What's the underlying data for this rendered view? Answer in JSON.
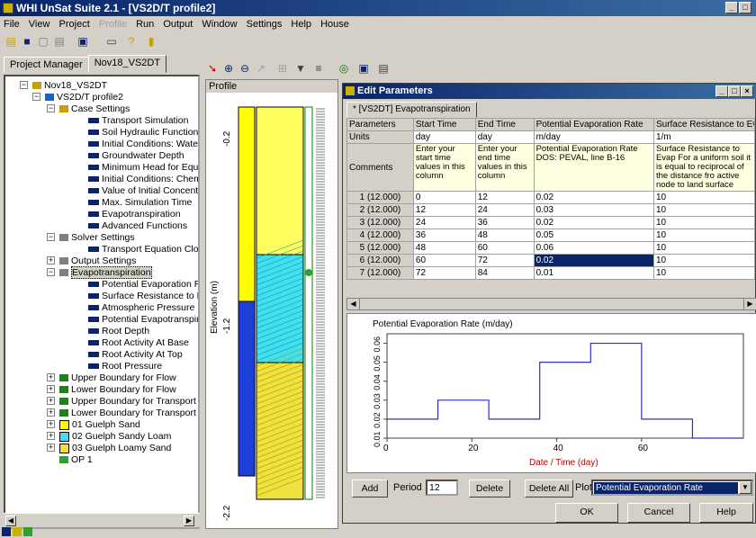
{
  "app": {
    "title": "WHI UnSat Suite 2.1 - [VS2D/T profile2]"
  },
  "menu": [
    "File",
    "View",
    "Project",
    "Profile",
    "Run",
    "Output",
    "Window",
    "Settings",
    "Help",
    "House"
  ],
  "left_tabs": [
    "Project Manager",
    "Nov18_VS2DT"
  ],
  "tree": [
    {
      "label": "Nov18_VS2DT",
      "x": 30,
      "y": 4,
      "exp": "-",
      "icon": "folder"
    },
    {
      "label": "VS2D/T profile2",
      "x": 44,
      "y": 17,
      "exp": "-",
      "icon": "flag"
    },
    {
      "label": "Case Settings",
      "x": 60,
      "y": 30,
      "exp": "-",
      "icon": "tool"
    },
    {
      "label": "Transport Simulation",
      "x": 92,
      "y": 43,
      "icon": "item"
    },
    {
      "label": "Soil Hydraulic Function",
      "x": 92,
      "y": 56,
      "icon": "item"
    },
    {
      "label": "Initial Conditions: Water",
      "x": 92,
      "y": 69,
      "icon": "item"
    },
    {
      "label": "Groundwater Depth",
      "x": 92,
      "y": 82,
      "icon": "item"
    },
    {
      "label": "Minimum Head for Equilibriu",
      "x": 92,
      "y": 95,
      "icon": "item"
    },
    {
      "label": "Initial Conditions: Chemical",
      "x": 92,
      "y": 108,
      "icon": "item"
    },
    {
      "label": "Value of Initial Concentratio",
      "x": 92,
      "y": 121,
      "icon": "item"
    },
    {
      "label": "Max. Simulation Time",
      "x": 92,
      "y": 134,
      "icon": "item"
    },
    {
      "label": "Evapotranspiration",
      "x": 92,
      "y": 147,
      "icon": "item"
    },
    {
      "label": "Advanced Functions",
      "x": 92,
      "y": 160,
      "icon": "item"
    },
    {
      "label": "Solver Settings",
      "x": 60,
      "y": 173,
      "exp": "-",
      "icon": "grid"
    },
    {
      "label": "Transport Equation Closure",
      "x": 92,
      "y": 186,
      "icon": "item"
    },
    {
      "label": "Output Settings",
      "x": 60,
      "y": 199,
      "exp": "+",
      "icon": "grid"
    },
    {
      "label": "Evapotranspiration",
      "x": 60,
      "y": 212,
      "exp": "-",
      "icon": "grid",
      "selected": true
    },
    {
      "label": "Potential Evaporation Rate",
      "x": 92,
      "y": 225,
      "icon": "item"
    },
    {
      "label": "Surface Resistance to Evap",
      "x": 92,
      "y": 238,
      "icon": "item"
    },
    {
      "label": "Atmospheric Pressure Poter",
      "x": 92,
      "y": 251,
      "icon": "item"
    },
    {
      "label": "Potential Evapotranspiration",
      "x": 92,
      "y": 264,
      "icon": "item"
    },
    {
      "label": "Root Depth",
      "x": 92,
      "y": 277,
      "icon": "item"
    },
    {
      "label": "Root Activity At Base",
      "x": 92,
      "y": 290,
      "icon": "item"
    },
    {
      "label": "Root Activity At Top",
      "x": 92,
      "y": 303,
      "icon": "item"
    },
    {
      "label": "Root Pressure",
      "x": 92,
      "y": 316,
      "icon": "item"
    },
    {
      "label": "Upper Boundary for Flow",
      "x": 60,
      "y": 329,
      "exp": "+",
      "icon": "bnd"
    },
    {
      "label": "Lower Boundary for Flow",
      "x": 60,
      "y": 342,
      "exp": "+",
      "icon": "bnd"
    },
    {
      "label": "Upper Boundary for Transport",
      "x": 60,
      "y": 355,
      "exp": "+",
      "icon": "bnd"
    },
    {
      "label": "Lower Boundary for Transport",
      "x": 60,
      "y": 368,
      "exp": "+",
      "icon": "bnd"
    },
    {
      "label": "01 Guelph Sand",
      "x": 60,
      "y": 381,
      "exp": "+",
      "icon": "soil1"
    },
    {
      "label": "02 Guelph Sandy Loam",
      "x": 60,
      "y": 394,
      "exp": "+",
      "icon": "soil2"
    },
    {
      "label": "03 Guelph Loamy Sand",
      "x": 60,
      "y": 407,
      "exp": "+",
      "icon": "soil3"
    },
    {
      "label": "OP 1",
      "x": 60,
      "y": 420,
      "icon": "op"
    }
  ],
  "profile": {
    "label": "Profile",
    "axis_label": "Elevation (m)",
    "ticks": [
      "-0.2",
      "-1.2",
      "-2.2"
    ]
  },
  "editor": {
    "title": "Edit Parameters",
    "tab": "* [VS2DT] Evapotranspiration",
    "headers": [
      "Parameters",
      "Start Time",
      "End Time",
      "Potential Evaporation Rate",
      "Surface Resistance to Evap"
    ],
    "units": [
      "Units",
      "day",
      "day",
      "m/day",
      "1/m"
    ],
    "comments": [
      "Comments",
      "Enter your start time values in this column",
      "Enter your end time values in this column",
      "Potential Evaporation Rate DOS: PEVAL, line B-16",
      "Surface Resistance to Evap For a uniform soil it is equal to reciprocal of the distance fro active node to land surface"
    ],
    "rows": [
      [
        "1 (12.000)",
        "0",
        "12",
        "0.02",
        "10"
      ],
      [
        "2 (12.000)",
        "12",
        "24",
        "0.03",
        "10"
      ],
      [
        "3 (12.000)",
        "24",
        "36",
        "0.02",
        "10"
      ],
      [
        "4 (12.000)",
        "36",
        "48",
        "0.05",
        "10"
      ],
      [
        "5 (12.000)",
        "48",
        "60",
        "0.06",
        "10"
      ],
      [
        "6 (12.000)",
        "60",
        "72",
        "0.02",
        "10"
      ],
      [
        "7 (12.000)",
        "72",
        "84",
        "0.01",
        "10"
      ]
    ],
    "selected_row": 5,
    "footer": {
      "add": "Add",
      "period_label": "Period",
      "period_value": "12",
      "delete": "Delete",
      "delete_all": "Delete All",
      "plot_label": "Plot",
      "plot_value": "Potential Evaporation Rate",
      "ok": "OK",
      "cancel": "Cancel",
      "help": "Help"
    }
  },
  "chart_data": {
    "type": "line",
    "title": "Potential Evaporation Rate (m/day)",
    "xlabel": "Date / Time (day)",
    "ylabel": "",
    "x": [
      0,
      12,
      12,
      24,
      24,
      36,
      36,
      48,
      48,
      60,
      60,
      72,
      72,
      84
    ],
    "y": [
      0.02,
      0.02,
      0.03,
      0.03,
      0.02,
      0.02,
      0.05,
      0.05,
      0.06,
      0.06,
      0.02,
      0.02,
      0.01,
      0.01
    ],
    "xlim": [
      0,
      84
    ],
    "ylim": [
      0.01,
      0.065
    ],
    "xticks": [
      "0",
      "20",
      "40",
      "60"
    ],
    "yticks": [
      "0.01",
      "0.02",
      "0.03",
      "0.04",
      "0.05",
      "0.06"
    ],
    "line_color": "#3030c0",
    "xlabel_color": "#c00000"
  }
}
